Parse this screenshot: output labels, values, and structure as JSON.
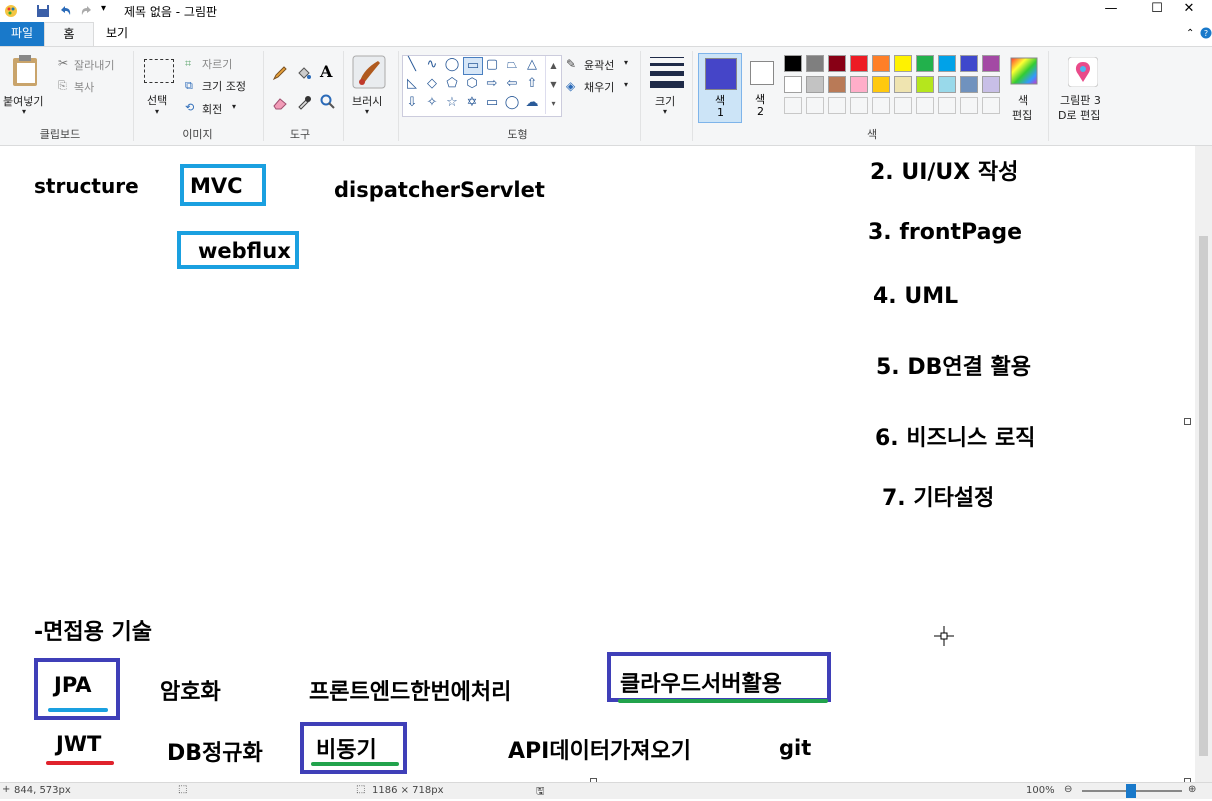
{
  "window": {
    "title": "제목 없음 - 그림판",
    "minimize": "—",
    "maximize": "☐",
    "close": "✕"
  },
  "menu": {
    "file": "파일",
    "home": "홈",
    "view": "보기"
  },
  "ribbon": {
    "clipboard": {
      "paste": "붙여넣기",
      "cut": "잘라내기",
      "copy": "복사",
      "label": "클립보드"
    },
    "image": {
      "select": "선택",
      "crop": "자르기",
      "resize": "크기 조정",
      "rotate": "회전",
      "label": "이미지"
    },
    "tools": {
      "label": "도구"
    },
    "brushes": {
      "label": "브러시"
    },
    "shapes": {
      "outline": "윤곽선",
      "fill": "채우기",
      "label": "도형"
    },
    "size": {
      "label": "크기"
    },
    "colors": {
      "color1": "색\n1",
      "color1_a": "색",
      "color1_b": "1",
      "color2_a": "색",
      "color2_b": "2",
      "edit_a": "색",
      "edit_b": "편집",
      "paint3d_a": "그림판 3",
      "paint3d_b": "D로 편집",
      "label": "색",
      "selected_color1": "#4545c8",
      "selected_color2": "#ffffff",
      "palette_row1": [
        "#000000",
        "#7f7f7f",
        "#880015",
        "#ed1c24",
        "#ff7f27",
        "#fff200",
        "#22b14c",
        "#00a2e8",
        "#3f48cc",
        "#a349a4"
      ],
      "palette_row2": [
        "#ffffff",
        "#c3c3c3",
        "#b97a57",
        "#ffaec9",
        "#ffc90e",
        "#efe4b0",
        "#b5e61d",
        "#99d9ea",
        "#7092be",
        "#c8bfe7"
      ]
    }
  },
  "canvas": {
    "structure": "structure",
    "mvc": "MVC",
    "dispatcher": "dispatcherServlet",
    "webflux": "webflux",
    "list": [
      "2. UI/UX 작성",
      "3. frontPage",
      "4. UML",
      "5. DB연결 활용",
      "6. 비즈니스 로직",
      "7. 기타설정"
    ],
    "interview_title": "-면접용 기술",
    "jpa": "JPA",
    "encryption": "암호화",
    "frontend": "프론트엔드한번에처리",
    "cloud": "클라우드서버활용",
    "jwt": "JWT",
    "db_norm": "DB정규화",
    "async": "비동기",
    "api": "API데이터가져오기",
    "git": "git",
    "box_colors": {
      "light_blue": "#1aa0e0",
      "indigo": "#3f3fb8",
      "green": "#22a34c",
      "red": "#e0222c"
    }
  },
  "status": {
    "position": "844, 573px",
    "size": "1186 × 718px",
    "zoom": "100%"
  }
}
